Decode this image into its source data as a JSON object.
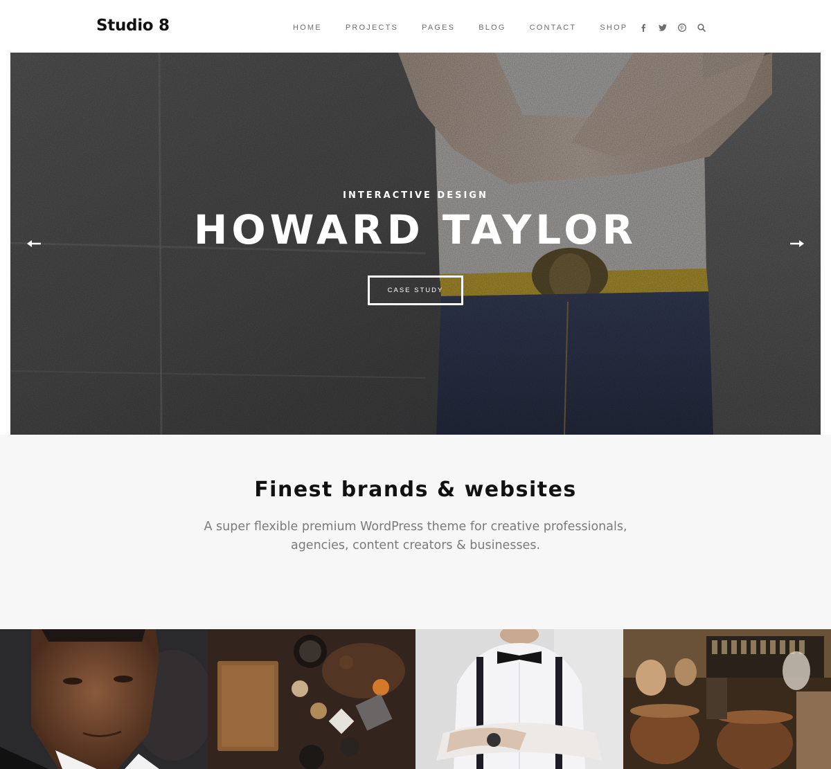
{
  "header": {
    "logo": "Studio 8",
    "nav": [
      "HOME",
      "PROJECTS",
      "PAGES",
      "BLOG",
      "CONTACT",
      "SHOP"
    ],
    "social_icons": [
      "facebook-icon",
      "twitter-icon",
      "pinterest-icon",
      "search-icon"
    ]
  },
  "hero": {
    "subtitle": "INTERACTIVE DESIGN",
    "title": "HOWARD TAYLOR",
    "button": "CASE STUDY",
    "prev_icon": "arrow-left-icon",
    "next_icon": "arrow-right-icon"
  },
  "intro": {
    "title": "Finest brands & websites",
    "text": "A super flexible premium WordPress theme for creative professionals, agencies, content creators & businesses."
  },
  "portfolio": {
    "tiles": [
      "portrait-photo",
      "kitchen-table-photo",
      "bow-tie-man-photo",
      "wine-bar-photo"
    ]
  },
  "colors": {
    "nav_text": "#6d6d6d",
    "intro_bg": "#f7f7f7",
    "intro_text": "#7a7a7a",
    "hero_text": "#ffffff"
  }
}
